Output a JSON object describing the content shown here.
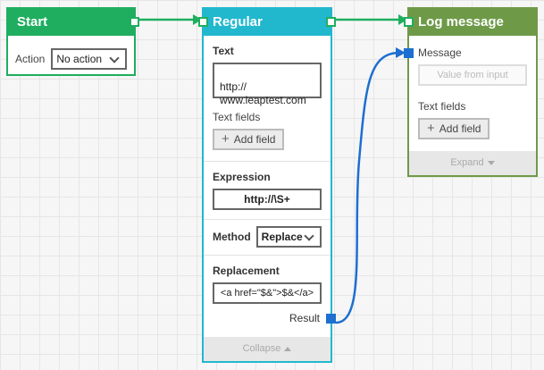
{
  "colors": {
    "start": "#1fae5f",
    "regex": "#21b8ce",
    "log": "#6e9a48",
    "link_green": "#1fae5f",
    "link_blue": "#1d6fd0"
  },
  "start": {
    "title": "Start",
    "action_label": "Action",
    "action_value": "No action"
  },
  "regex": {
    "title": "Regular expression",
    "text_label": "Text",
    "text_value": "http://\nwww.leaptest.com",
    "text_fields_label": "Text fields",
    "add_field_label": "Add field",
    "expression_label": "Expression",
    "expression_value": "http://\\S+",
    "method_label": "Method",
    "method_value": "Replace",
    "replacement_label": "Replacement",
    "replacement_value": "<a href=\"$&\">$&</a>",
    "result_label": "Result",
    "collapse_label": "Collapse"
  },
  "log": {
    "title": "Log message",
    "message_label": "Message",
    "message_placeholder": "Value from input",
    "text_fields_label": "Text fields",
    "add_field_label": "Add field",
    "expand_label": "Expand"
  }
}
